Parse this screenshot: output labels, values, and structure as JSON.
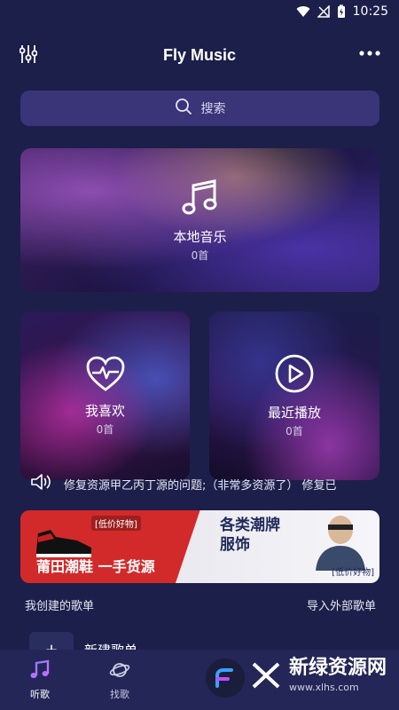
{
  "status_bar": {
    "time": "10:25"
  },
  "header": {
    "title": "Fly Music"
  },
  "search": {
    "placeholder": "搜索"
  },
  "cards": {
    "local": {
      "label": "本地音乐",
      "count": "0首"
    },
    "favorite": {
      "label": "我喜欢",
      "count": "0首"
    },
    "recent": {
      "label": "最近播放",
      "count": "0首"
    }
  },
  "notice": {
    "text": "修复资源甲乙丙丁源的问题;（非常多资源了） 修复已"
  },
  "banner": {
    "tag_left": "[低价好物]",
    "slogan_left": "莆田潮鞋 一手货源",
    "slogan_right_line1": "各类潮牌",
    "slogan_right_line2": "服饰",
    "tag_right": "[低价好物]"
  },
  "playlists": {
    "my_created": "我创建的歌单",
    "import_external": "导入外部歌单",
    "new_playlist": "新建歌单"
  },
  "bottom_nav": {
    "items": [
      {
        "label": "听歌"
      },
      {
        "label": "找歌"
      }
    ]
  },
  "watermark": {
    "brand": "新绿资源网",
    "url": "www.xlhs.com"
  },
  "colors": {
    "background": "#1c1f4a",
    "search_bg": "#3a3478",
    "nav_bg": "#232656",
    "banner_red": "#d22a2a"
  }
}
